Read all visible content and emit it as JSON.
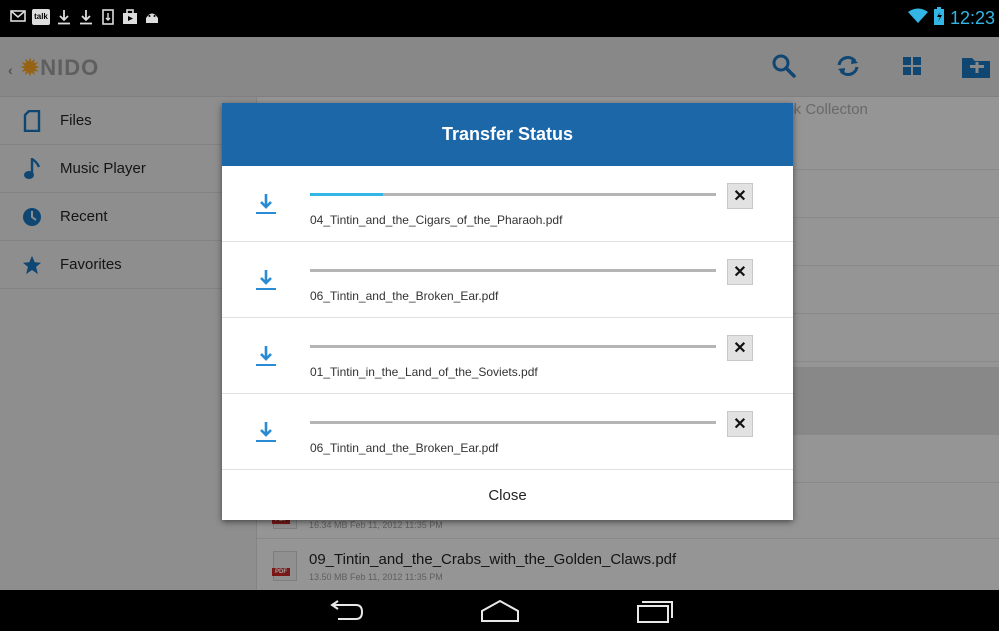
{
  "status_bar": {
    "icons": [
      "gmail-icon",
      "talk-icon",
      "download-icon",
      "download-icon",
      "sd-icon",
      "briefcase-icon",
      "android-icon"
    ],
    "talk_label": "talk",
    "time": "12:23"
  },
  "action_bar": {
    "logo_text": "NIDO",
    "actions": [
      "search-icon",
      "refresh-icon",
      "grid-view-icon",
      "new-folder-icon"
    ]
  },
  "sidebar": {
    "items": [
      {
        "label": "Files",
        "icon": "file-icon"
      },
      {
        "label": "Music Player",
        "icon": "music-note-icon"
      },
      {
        "label": "Recent",
        "icon": "clock-icon"
      },
      {
        "label": "Favorites",
        "icon": "star-icon"
      }
    ]
  },
  "main": {
    "breadcrumb_tail": "ook Collecton",
    "files": [
      {
        "name": "",
        "meta": "16.34 MB  Feb 11, 2012 11:35 PM"
      },
      {
        "name": "09_Tintin_and_the_Crabs_with_the_Golden_Claws.pdf",
        "meta": "13.50 MB  Feb 11, 2012 11:35 PM"
      }
    ]
  },
  "dialog": {
    "title": "Transfer Status",
    "transfers": [
      {
        "filename": "04_Tintin_and_the_Cigars_of_the_Pharaoh.pdf",
        "progress": 0.18
      },
      {
        "filename": "06_Tintin_and_the_Broken_Ear.pdf",
        "progress": 0
      },
      {
        "filename": "01_Tintin_in_the_Land_of_the_Soviets.pdf",
        "progress": 0
      },
      {
        "filename": "06_Tintin_and_the_Broken_Ear.pdf",
        "progress": 0
      }
    ],
    "cancel_label": "✕",
    "close_label": "Close"
  },
  "nav_bar": {
    "buttons": [
      "back-icon",
      "home-icon",
      "recent-apps-icon"
    ]
  },
  "colors": {
    "accent": "#33b5e5",
    "dialog_header": "#1b67a8",
    "icon_blue": "#1b72b8"
  }
}
